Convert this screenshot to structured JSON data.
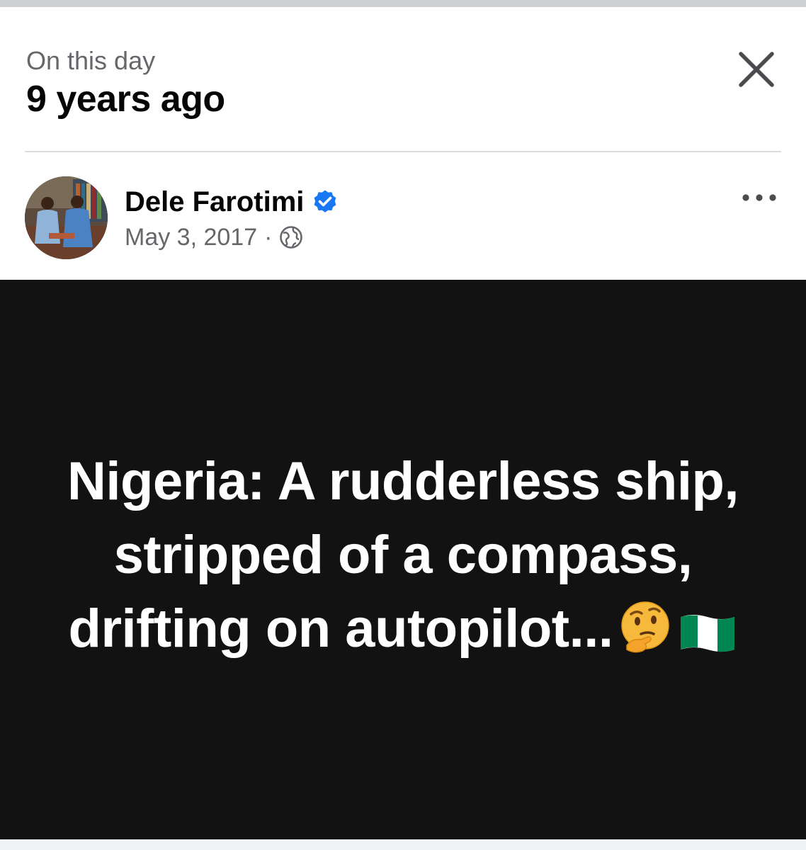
{
  "memory": {
    "label": "On this day",
    "title": "9 years ago"
  },
  "post": {
    "author": "Dele Farotimi",
    "date": "May 3, 2017",
    "separator": "·",
    "audience_icon": "globe-icon",
    "verified_icon": "verified-badge-icon",
    "image_text": "Nigeria: A rudderless ship, stripped of a compass, drifting on autopilot...",
    "image_emojis": [
      "thinking-face",
      "nigeria-flag"
    ]
  },
  "icons": {
    "close": "close-icon",
    "more": "more-options-icon"
  },
  "colors": {
    "verified": "#1877f2",
    "secondary_text": "#65676b",
    "primary_text": "#050505",
    "image_background": "#121212",
    "nigeria_green": "#008751"
  }
}
